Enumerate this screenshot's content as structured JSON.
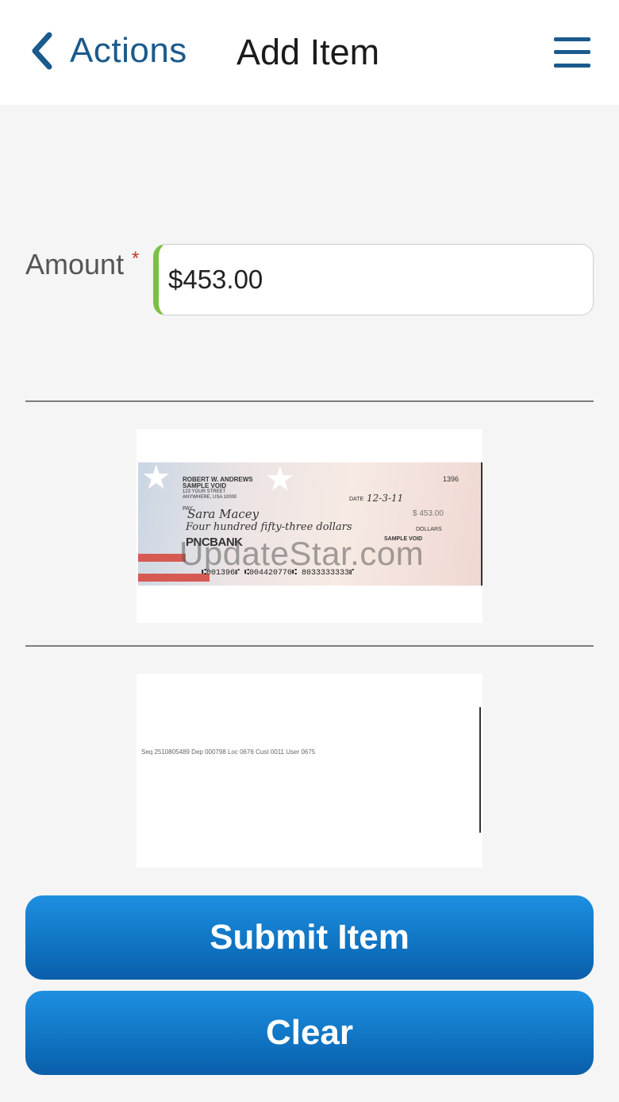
{
  "header": {
    "back_label": "Actions",
    "title": "Add Item"
  },
  "form": {
    "amount_label": "Amount",
    "required_marker": "*",
    "amount_value": "$453.00"
  },
  "check_front": {
    "name_line1": "ROBERT W. ANDREWS",
    "name_line2": "SAMPLE VOID",
    "addr_line1": "123 YOUR STREET",
    "addr_line2": "ANYWHERE, USA 10000",
    "check_number": "1396",
    "date_label": "DATE",
    "date_value": "12-3-11",
    "pay_label": "PAY",
    "payee": "Sara Macey",
    "amount_box": "$ 453.00",
    "written_amount": "Four hundred fifty-three dollars",
    "dollars_label": "DOLLARS",
    "bank": "PNCBANK",
    "sample_void": "SAMPLE VOID",
    "micr": "⑆001396⑈ ⑆004420770⑆ 8033333333⑈"
  },
  "check_back": {
    "endorsement": "Seq 2510805489 Dep 000798 Loc 0676 Cust 0011 User 0675"
  },
  "watermark": "UpdateStar.com",
  "buttons": {
    "submit": "Submit Item",
    "clear": "Clear"
  },
  "colors": {
    "accent": "#1a5a8c",
    "button": "#0f73c2",
    "input_indicator": "#7ac143",
    "required": "#c0392b"
  }
}
